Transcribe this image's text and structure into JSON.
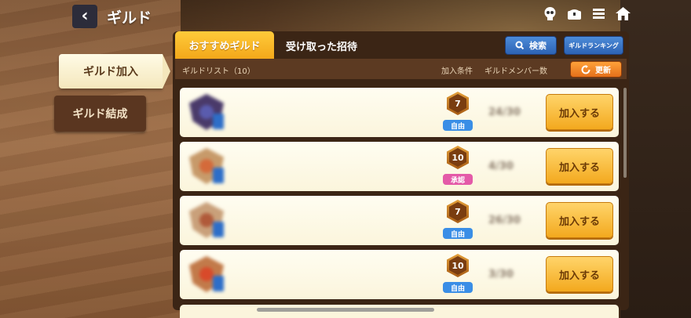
{
  "header": {
    "title": "ギルド",
    "back_icon": "chevron-left-icon",
    "icons": [
      "skull-icon",
      "chest-icon",
      "menu-icon",
      "home-icon"
    ]
  },
  "sidebar": {
    "items": [
      {
        "label": "ギルド加入",
        "active": true
      },
      {
        "label": "ギルド結成",
        "active": false
      }
    ]
  },
  "tabs": [
    {
      "label": "おすすめギルド",
      "active": true
    },
    {
      "label": "受け取った招待",
      "active": false
    }
  ],
  "toolbar": {
    "search_label": "検索",
    "ranking_label": "ギルドランキング",
    "refresh_label": "更新"
  },
  "list": {
    "title": "ギルドリスト（10）",
    "col_condition": "加入条件",
    "col_members": "ギルドメンバー数",
    "rows": [
      {
        "level": "7",
        "condition": "自由",
        "condition_color": "#3a8ee6",
        "members": "24/30",
        "join_label": "加入する",
        "emblem_color": "#4a3a6a",
        "core_color": "#5a5cae"
      },
      {
        "level": "10",
        "condition": "承認",
        "condition_color": "#e45aa8",
        "members": "4/30",
        "join_label": "加入する",
        "emblem_color": "#c79a6a",
        "core_color": "#d46a3a"
      },
      {
        "level": "7",
        "condition": "自由",
        "condition_color": "#3a8ee6",
        "members": "26/30",
        "join_label": "加入する",
        "emblem_color": "#c9a07a",
        "core_color": "#b05a3a"
      },
      {
        "level": "10",
        "condition": "自由",
        "condition_color": "#3a8ee6",
        "members": "3/30",
        "join_label": "加入する",
        "emblem_color": "#c27a4a",
        "core_color": "#d84a2a"
      }
    ]
  }
}
